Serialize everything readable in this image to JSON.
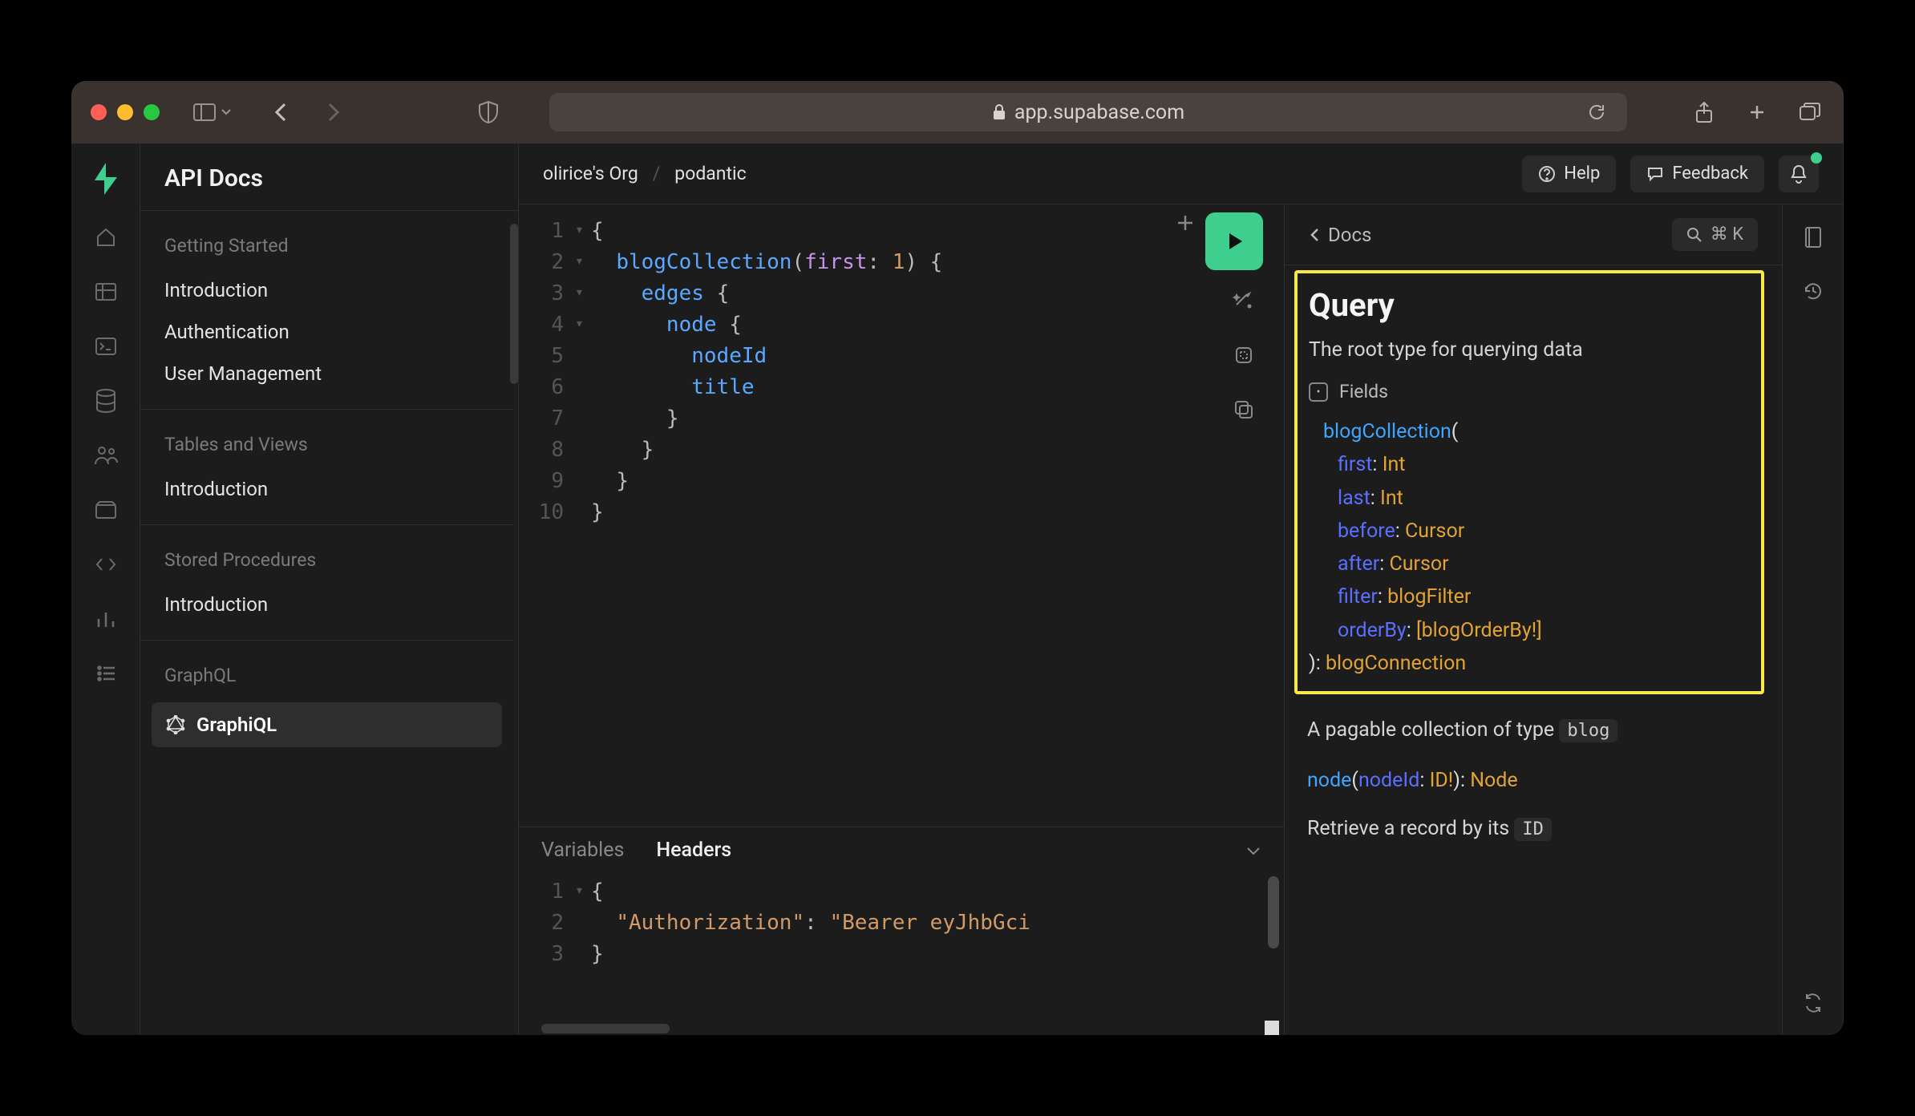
{
  "browser": {
    "url_host": "app.supabase.com"
  },
  "header": {
    "page_title": "API Docs",
    "breadcrumb_org": "olirice's Org",
    "breadcrumb_project": "podantic",
    "help_label": "Help",
    "feedback_label": "Feedback"
  },
  "sidebar": {
    "sections": [
      {
        "heading": "Getting Started",
        "items": [
          "Introduction",
          "Authentication",
          "User Management"
        ]
      },
      {
        "heading": "Tables and Views",
        "items": [
          "Introduction"
        ]
      },
      {
        "heading": "Stored Procedures",
        "items": [
          "Introduction"
        ]
      },
      {
        "heading": "GraphQL",
        "items": [
          "GraphiQL"
        ]
      }
    ]
  },
  "editor": {
    "lines": [
      {
        "n": "1",
        "fold": "▾",
        "html": "<span class='tok-punc'>{</span>"
      },
      {
        "n": "2",
        "fold": "▾",
        "html": "  <span class='tok-field'>blogCollection</span><span class='tok-punc'>(</span><span class='tok-arg'>first</span><span class='tok-punc'>: </span><span class='tok-num'>1</span><span class='tok-punc'>) {</span>"
      },
      {
        "n": "3",
        "fold": "▾",
        "html": "    <span class='tok-field'>edges</span> <span class='tok-punc'>{</span>"
      },
      {
        "n": "4",
        "fold": "▾",
        "html": "      <span class='tok-field'>node</span> <span class='tok-punc'>{</span>"
      },
      {
        "n": "5",
        "fold": "",
        "html": "        <span class='tok-field'>nodeId</span>"
      },
      {
        "n": "6",
        "fold": "",
        "html": "        <span class='tok-field'>title</span>"
      },
      {
        "n": "7",
        "fold": "",
        "html": "      <span class='tok-punc'>}</span>"
      },
      {
        "n": "8",
        "fold": "",
        "html": "    <span class='tok-punc'>}</span>"
      },
      {
        "n": "9",
        "fold": "",
        "html": "  <span class='tok-punc'>}</span>"
      },
      {
        "n": "10",
        "fold": "",
        "html": "<span class='tok-punc'>}</span>"
      }
    ]
  },
  "vars": {
    "tab_variables": "Variables",
    "tab_headers": "Headers",
    "lines": [
      {
        "n": "1",
        "fold": "▾",
        "html": "<span class='tok-punc'>{</span>"
      },
      {
        "n": "2",
        "fold": "",
        "html": "  <span class='tok-str'>\"Authorization\"</span><span class='tok-punc'>: </span><span class='tok-str'>\"Bearer eyJhbGci</span>"
      },
      {
        "n": "3",
        "fold": "",
        "html": "<span class='tok-punc'>}</span>"
      }
    ]
  },
  "docs": {
    "back_label": "Docs",
    "search_hint": "⌘ K",
    "title": "Query",
    "description": "The root type for querying data",
    "fields_label": "Fields",
    "signature": {
      "name": "blogCollection",
      "args": [
        {
          "name": "first",
          "type": "Int"
        },
        {
          "name": "last",
          "type": "Int"
        },
        {
          "name": "before",
          "type": "Cursor"
        },
        {
          "name": "after",
          "type": "Cursor"
        },
        {
          "name": "filter",
          "type": "blogFilter"
        },
        {
          "name": "orderBy",
          "type": "[blogOrderBy!]"
        }
      ],
      "return_type": "blogConnection"
    },
    "collection_desc_prefix": "A pagable collection of type ",
    "collection_type_chip": "blog",
    "node_sig": {
      "name": "node",
      "arg": "nodeId",
      "arg_type": "ID!",
      "return": "Node"
    },
    "node_desc_prefix": "Retrieve a record by its ",
    "node_chip": "ID"
  }
}
